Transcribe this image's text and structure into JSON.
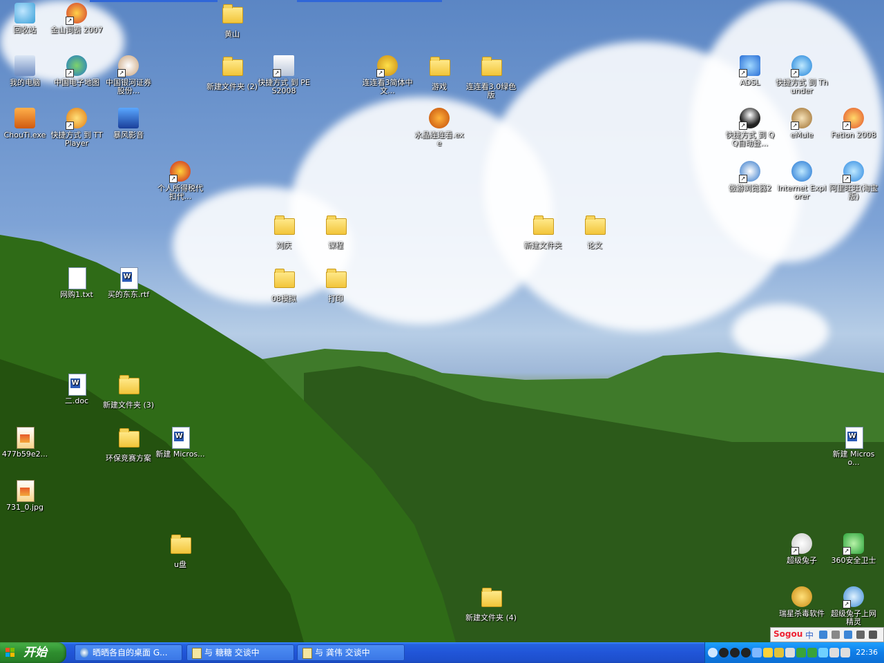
{
  "desktop": {
    "icons": [
      {
        "label": "回收站",
        "kind": "recycle"
      },
      {
        "label": "金山词霸 2007",
        "kind": "app"
      },
      {
        "label": "黄山",
        "kind": "folder"
      },
      {
        "label": "我的电脑",
        "kind": "mycomputer"
      },
      {
        "label": "中国电子地图",
        "kind": "app"
      },
      {
        "label": "中国银河证券股份...",
        "kind": "app"
      },
      {
        "label": "新建文件夹 (2)",
        "kind": "folder"
      },
      {
        "label": "快捷方式 到 PES2008",
        "kind": "app"
      },
      {
        "label": "连连看3简体中文...",
        "kind": "app"
      },
      {
        "label": "游戏",
        "kind": "folder"
      },
      {
        "label": "连连看3.0绿色版",
        "kind": "folder"
      },
      {
        "label": "ADSL",
        "kind": "app"
      },
      {
        "label": "快捷方式 到 Thunder",
        "kind": "app"
      },
      {
        "label": "ChouTi.exe",
        "kind": "app"
      },
      {
        "label": "快捷方式 到 TTPlayer",
        "kind": "app"
      },
      {
        "label": "暴风影音",
        "kind": "app"
      },
      {
        "label": "水晶连连看.exe",
        "kind": "app"
      },
      {
        "label": "快捷方式 到 QQ自动登...",
        "kind": "app"
      },
      {
        "label": "eMule",
        "kind": "app"
      },
      {
        "label": "Fetion 2008",
        "kind": "app"
      },
      {
        "label": "个人所得税代扣代...",
        "kind": "app"
      },
      {
        "label": "傲游浏览器2",
        "kind": "app"
      },
      {
        "label": "Internet Explorer",
        "kind": "app"
      },
      {
        "label": "阿里旺旺(淘宝版)",
        "kind": "app"
      },
      {
        "label": "刘庆",
        "kind": "folder"
      },
      {
        "label": "课程",
        "kind": "folder"
      },
      {
        "label": "新建文件夹",
        "kind": "folder"
      },
      {
        "label": "论文",
        "kind": "folder"
      },
      {
        "label": "网购1.txt",
        "kind": "doc"
      },
      {
        "label": "买的东东.rtf",
        "kind": "doc"
      },
      {
        "label": "08模拟",
        "kind": "folder"
      },
      {
        "label": "打印",
        "kind": "folder"
      },
      {
        "label": "二.doc",
        "kind": "doc"
      },
      {
        "label": "新建文件夹 (3)",
        "kind": "folder"
      },
      {
        "label": "477b59e2...",
        "kind": "image"
      },
      {
        "label": "环保竞赛方案",
        "kind": "folder"
      },
      {
        "label": "新建 Micros...",
        "kind": "doc"
      },
      {
        "label": "新建 Microso...",
        "kind": "doc"
      },
      {
        "label": "731_0.jpg",
        "kind": "image"
      },
      {
        "label": "u盘",
        "kind": "folder"
      },
      {
        "label": "超级兔子",
        "kind": "app"
      },
      {
        "label": "360安全卫士",
        "kind": "app"
      },
      {
        "label": "新建文件夹 (4)",
        "kind": "folder"
      },
      {
        "label": "瑞星杀毒软件",
        "kind": "app"
      },
      {
        "label": "超级兔子上网精灵",
        "kind": "app"
      }
    ]
  },
  "taskbar": {
    "start_label": "开始",
    "tasks": [
      {
        "label": "晒晒各自的桌面 G..."
      },
      {
        "label": "与 糖糖 交谈中"
      },
      {
        "label": "与 龚伟 交谈中"
      }
    ],
    "clock": "22:36",
    "ime": {
      "brand": "Sogou",
      "mode": "中"
    }
  },
  "colors": {
    "taskbar": "#2155d8",
    "start": "#2e8d2e",
    "tray": "#0f7ee8"
  }
}
